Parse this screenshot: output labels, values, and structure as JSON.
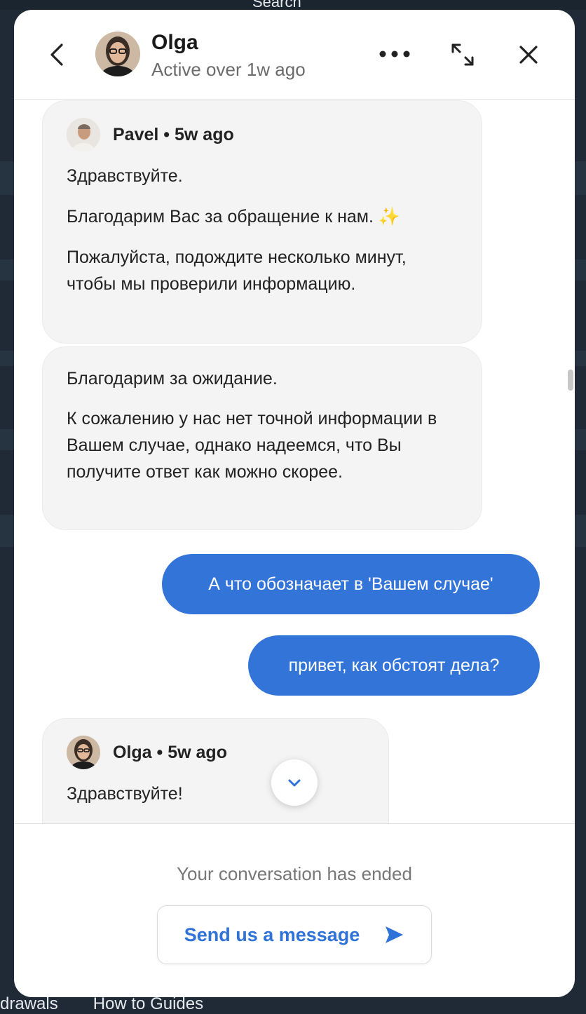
{
  "background": {
    "top_items": [
      "Search"
    ],
    "bottom_links": [
      "drawals",
      "How to Guides"
    ]
  },
  "header": {
    "name": "Olga",
    "status": "Active over 1w ago"
  },
  "messages": [
    {
      "sender": "Pavel",
      "time": "5w ago",
      "paragraphs": [
        "Здравствуйте.",
        "Благодарим Вас за обращение к нам. ✨",
        "Пожалуйста, подождите несколько минут, чтобы мы проверили информацию."
      ]
    },
    {
      "paragraphs": [
        "Благодарим за ожидание.",
        "К сожалению у нас нет точной информации в Вашем случае, однако надеемся, что Вы получите ответ как можно скорее."
      ]
    },
    {
      "text": "А что обозначает в 'Вашем случае'"
    },
    {
      "text": "привет, как обстоят дела?"
    },
    {
      "sender": "Olga",
      "time": "5w ago",
      "paragraphs": [
        "Здравствуйте!"
      ]
    }
  ],
  "footer": {
    "ended_text": "Your conversation has ended",
    "send_label": "Send us a message"
  },
  "colors": {
    "accent": "#3374d9",
    "bubble_in": "#f4f4f4"
  },
  "icons": [
    "back-arrow-icon",
    "more-dots-icon",
    "expand-icon",
    "close-icon",
    "chevron-down-icon",
    "send-arrow-icon"
  ]
}
